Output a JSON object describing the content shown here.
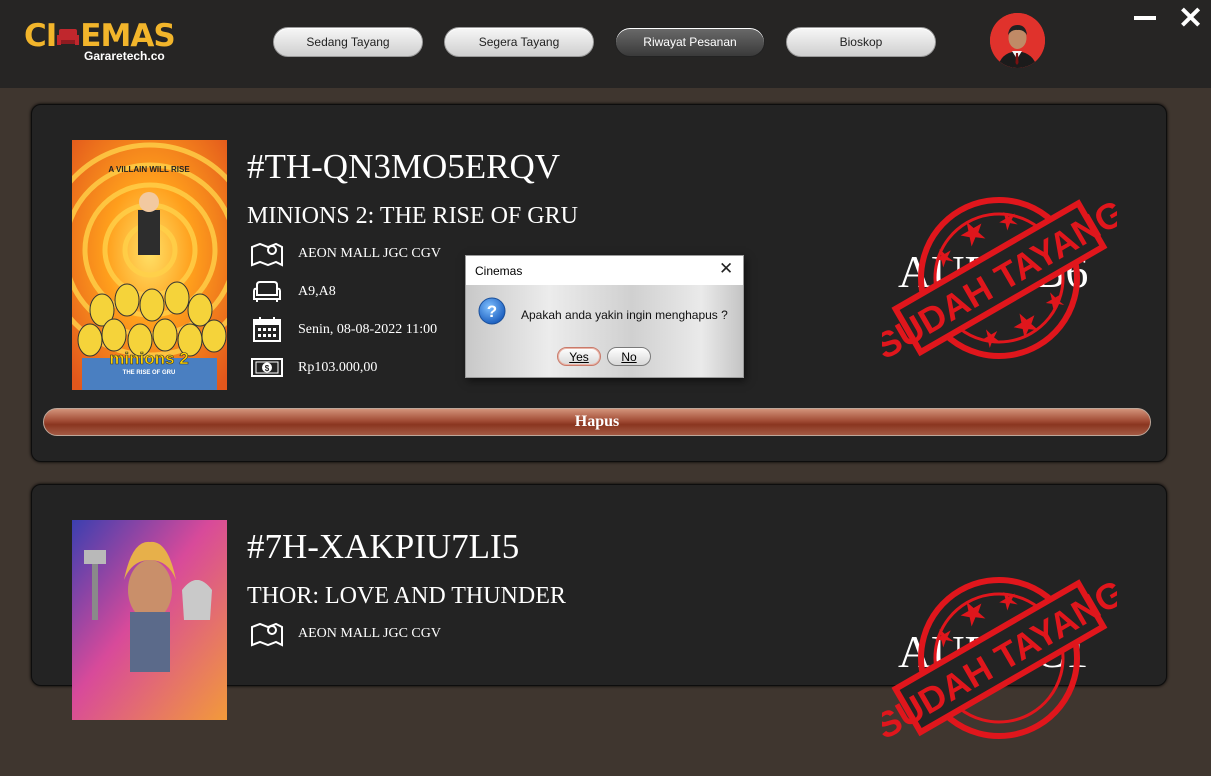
{
  "header": {
    "logo_text": "CINEMAS",
    "logo_left": "CI",
    "logo_right": "EMAS",
    "logo_sub": "Gararetech.co",
    "nav": [
      {
        "label": "Sedang Tayang",
        "active": false
      },
      {
        "label": "Segera Tayang",
        "active": false
      },
      {
        "label": "Riwayat Pesanan",
        "active": true
      },
      {
        "label": "Bioskop",
        "active": false
      }
    ]
  },
  "orders": [
    {
      "code": "#TH-QN3MO5ERQV",
      "title": "MINIONS 2: THE RISE OF GRU",
      "cinema": "AEON MALL JGC CGV",
      "seats": "A9,A8",
      "datetime": "Senin, 08-08-2022 11:00",
      "price": "Rp103.000,00",
      "hall": "AULA B6",
      "stamp": "SUDAH TAYANG",
      "delete_label": "Hapus",
      "poster_tagline": "A VILLAIN WILL RISE",
      "poster_title": "minions 2",
      "poster_subtitle": "THE RISE OF GRU"
    },
    {
      "code": "#7H-XAKPIU7LI5",
      "title": "THOR: LOVE AND THUNDER",
      "cinema": "AEON MALL JGC CGV",
      "hall": "AULA C1",
      "stamp": "SUDAH TAYANG"
    }
  ],
  "dialog": {
    "title": "Cinemas",
    "message": "Apakah anda yakin ingin menghapus ?",
    "yes_label": "Yes",
    "no_label": "No",
    "close_label": "✕"
  },
  "colors": {
    "header_bg": "#262524",
    "page_bg": "#3f362f",
    "card_bg": "#232323",
    "logo_accent": "#f2b52b",
    "stamp_red": "#e0161c",
    "delete_button": "#a24d36"
  }
}
